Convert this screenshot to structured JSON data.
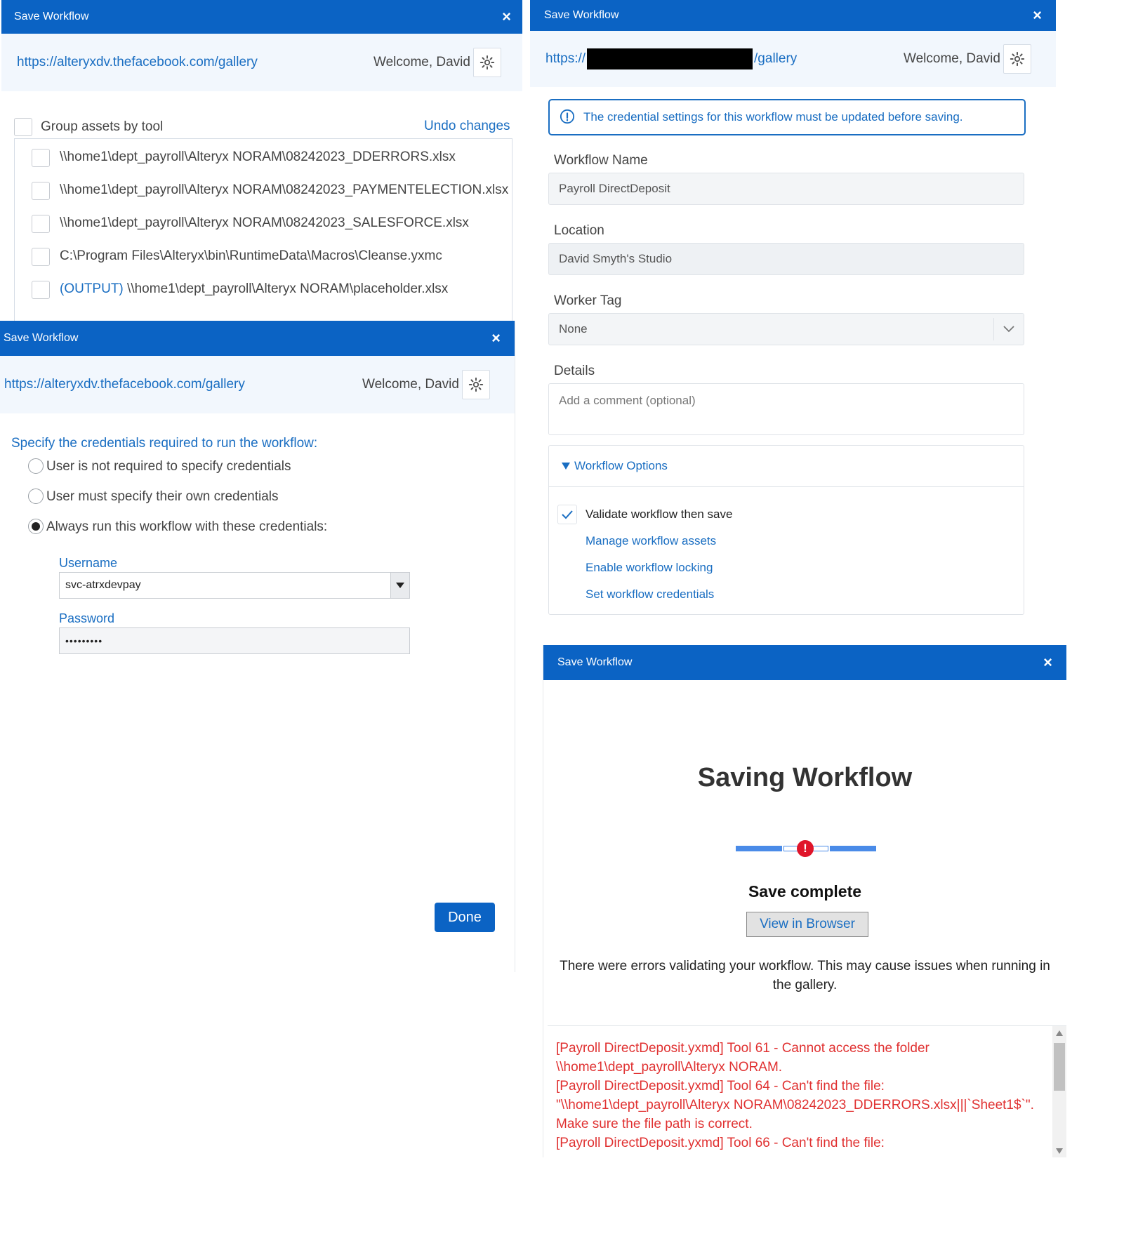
{
  "colors": {
    "titlebar": "#0b63c4",
    "link": "#1a6ec2",
    "error": "#e03131",
    "progress": "#4a8be8"
  },
  "assets_panel": {
    "title": "Save Workflow",
    "close": "×",
    "url": "https://alteryxdv.thefacebook.com/gallery",
    "welcome": "Welcome, David",
    "group_label": "Group assets by tool",
    "undo": "Undo changes",
    "assets": [
      {
        "prefix": "",
        "path": "\\\\home1\\dept_payroll\\Alteryx NORAM\\08242023_DDERRORS.xlsx"
      },
      {
        "prefix": "",
        "path": "\\\\home1\\dept_payroll\\Alteryx NORAM\\08242023_PAYMENTELECTION.xlsx"
      },
      {
        "prefix": "",
        "path": "\\\\home1\\dept_payroll\\Alteryx NORAM\\08242023_SALESFORCE.xlsx"
      },
      {
        "prefix": "",
        "path": "C:\\Program Files\\Alteryx\\bin\\RuntimeData\\Macros\\Cleanse.yxmc"
      },
      {
        "prefix": "(OUTPUT)",
        "path": " \\\\home1\\dept_payroll\\Alteryx NORAM\\placeholder.xlsx"
      }
    ]
  },
  "cred_panel": {
    "title": "Save Workflow",
    "close": "×",
    "url": "https://alteryxdv.thefacebook.com/gallery",
    "welcome": "Welcome, David",
    "prompt": "Specify the credentials required to run the workflow:",
    "opt1": "User is not required to specify credentials",
    "opt2": "User must specify their own credentials",
    "opt3": "Always run this workflow with these credentials:",
    "selected": 3,
    "username_label": "Username",
    "username_value": "svc-atrxdevpay",
    "password_label": "Password",
    "password_value": "•••••••••",
    "done": "Done"
  },
  "form_panel": {
    "title": "Save Workflow",
    "close": "×",
    "url_start": "https://",
    "url_end": "/gallery",
    "welcome": "Welcome, David",
    "alert": "The credential settings for this workflow must be updated before saving.",
    "name_label": "Workflow Name",
    "name_value": "Payroll DirectDeposit",
    "location_label": "Location",
    "location_value": "David Smyth's Studio",
    "worker_label": "Worker Tag",
    "worker_value": "None",
    "details_label": "Details",
    "details_placeholder": "Add a comment (optional)",
    "options_title": "Workflow Options",
    "validate_label": "Validate workflow then save",
    "validate_checked": true,
    "link1": "Manage workflow assets",
    "link2": "Enable workflow locking",
    "link3": "Set workflow credentials"
  },
  "saving_panel": {
    "title": "Save Workflow",
    "close": "×",
    "heading": "Saving Workflow",
    "error_marker": "!",
    "status": "Save complete",
    "view_button": "View in Browser",
    "message": "There were errors validating your workflow. This may cause issues when running in the gallery.",
    "errors": [
      "[Payroll DirectDeposit.yxmd] Tool 61 - Cannot access the folder \\\\home1\\dept_payroll\\Alteryx NORAM.",
      "[Payroll DirectDeposit.yxmd] Tool 64 - Can't find the file: \"\\\\home1\\dept_payroll\\Alteryx NORAM\\08242023_DDERRORS.xlsx|||`Sheet1$`\". Make sure the file path is correct.",
      "[Payroll DirectDeposit.yxmd] Tool 66 - Can't find the file:"
    ]
  }
}
